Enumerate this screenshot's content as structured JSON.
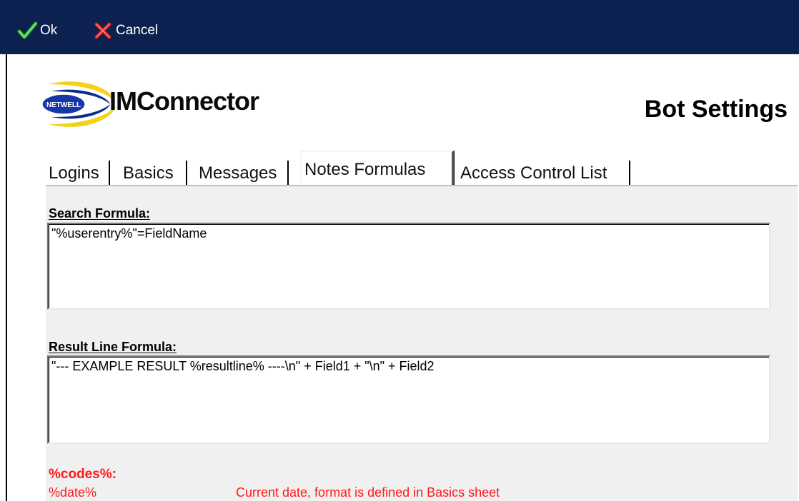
{
  "toolbar": {
    "ok_label": "Ok",
    "cancel_label": "Cancel",
    "ok_icon": "checkmark-icon",
    "cancel_icon": "x-cross-icon",
    "background": "#0c2150"
  },
  "header": {
    "logo_text": "NETWELL",
    "brand": "IMConnector",
    "title": "Bot Settings"
  },
  "tabs": [
    {
      "label": "Logins",
      "active": false
    },
    {
      "label": "Basics",
      "active": false
    },
    {
      "label": "Messages",
      "active": false
    },
    {
      "label": "Notes Formulas",
      "active": true
    },
    {
      "label": "Access Control List",
      "active": false
    }
  ],
  "form": {
    "search_label": "Search Formula:",
    "search_value": "\"%userentry%\"=FieldName",
    "result_label": "Result Line Formula:",
    "result_value": "\"--- EXAMPLE RESULT %resultline% ----\\n\" + Field1 + \"\\n\" + Field2"
  },
  "codes": {
    "title": "%codes%:",
    "items": [
      {
        "code": "%date%",
        "description": "Current date, format is defined in Basics sheet"
      }
    ],
    "color": "#ff1a1a"
  }
}
